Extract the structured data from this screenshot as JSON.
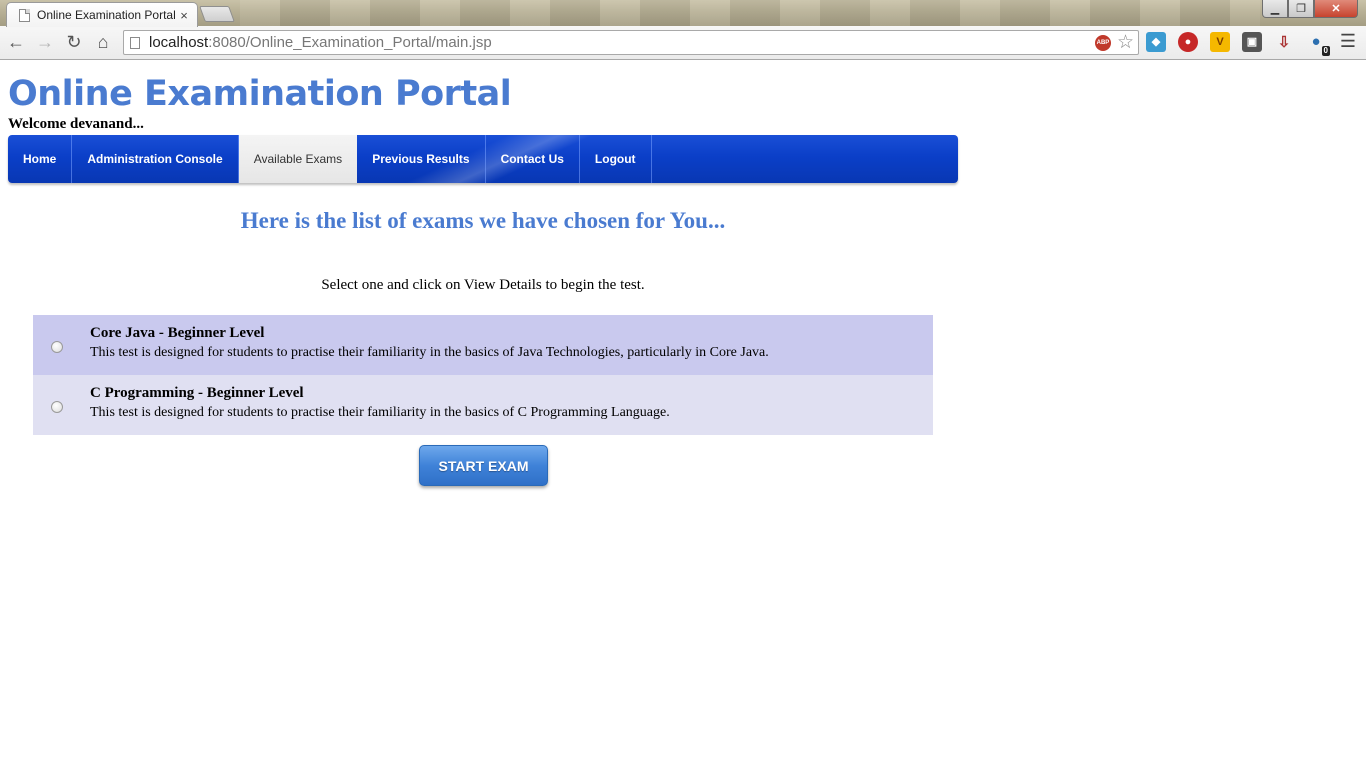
{
  "browser": {
    "tab_title": "Online Examination Portal",
    "tab_close": "×",
    "url_host": "localhost",
    "url_path": ":8080/Online_Examination_Portal/main.jsp",
    "extension_badge": "0",
    "window_controls": {
      "minimize": "▁",
      "maximize": "❐",
      "close": "✕"
    }
  },
  "header": {
    "title": "Online Examination Portal",
    "welcome": "Welcome devanand..."
  },
  "nav": {
    "items": [
      {
        "label": "Home",
        "active": false
      },
      {
        "label": "Administration Console",
        "active": false
      },
      {
        "label": "Available Exams",
        "active": true
      },
      {
        "label": "Previous Results",
        "active": false
      },
      {
        "label": "Contact Us",
        "active": false
      },
      {
        "label": "Logout",
        "active": false
      }
    ]
  },
  "main": {
    "headline": "Here is the list of exams we have chosen for You...",
    "instruction": "Select one and click on View Details to begin the test.",
    "exams": [
      {
        "name": "Core Java - Beginner Level",
        "description": "This test is designed for students to practise their familiarity in the basics of Java Technologies, particularly in Core Java.",
        "selected": false
      },
      {
        "name": "C Programming - Beginner Level",
        "description": "This test is designed for students to practise their familiarity in the basics of C Programming Language.",
        "selected": false
      }
    ],
    "start_button": "START EXAM"
  },
  "colors": {
    "title_blue": "#4a7bd0",
    "nav_blue": "#0b3fc8",
    "row_odd": "#c9c9ee",
    "row_even": "#e0e0f2",
    "button_blue": "#3f82d8"
  }
}
